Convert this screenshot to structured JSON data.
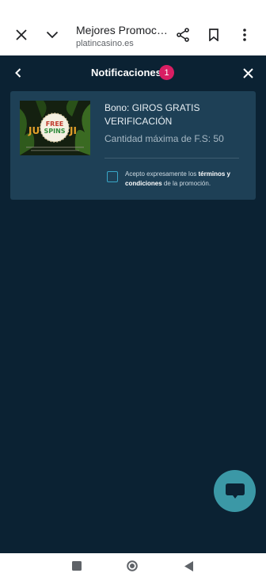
{
  "browser": {
    "title": "Mejores Promoc…",
    "url": "platincasino.es",
    "icons": [
      "close-icon",
      "chevron-down-icon",
      "share-icon",
      "bookmark-icon",
      "more-vert-icon"
    ]
  },
  "notifications": {
    "title": "Notificaciones",
    "badge_count": "1"
  },
  "card": {
    "thumbnail_text": {
      "line1": "FREE",
      "line2": "SPINS"
    },
    "title": "Bono: GIROS GRATIS VERIFICACIÓN",
    "subtitle": "Cantidad máxima de F.S: 50",
    "terms_prefix": "Acepto expresamente los ",
    "terms_link": "términos y condiciones",
    "terms_suffix": " de la promoción."
  },
  "colors": {
    "app_bg": "#0b2233",
    "card_bg": "#1e4056",
    "badge": "#d91e63",
    "chat_fab": "#3b98a6",
    "checkbox_border": "#39a6c6"
  },
  "chat": {
    "icon": "chat-bubble-icon"
  },
  "nav": {
    "icons": [
      "square-icon",
      "circle-icon",
      "back-triangle-icon"
    ]
  }
}
